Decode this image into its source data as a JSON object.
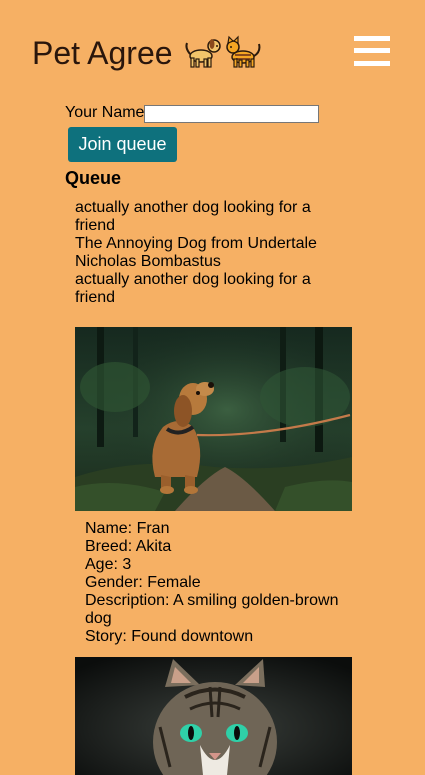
{
  "header": {
    "title": "Pet Agree",
    "title_emoji": "🐕🐈",
    "menu_icon": "hamburger-menu-icon"
  },
  "form": {
    "name_label": "Your Name",
    "name_value": "",
    "join_label": "Join queue"
  },
  "queue": {
    "heading": "Queue",
    "entries": [
      "actually another dog looking for a friend",
      "The Annoying Dog from Undertale",
      "Nicholas Bombastus",
      "actually another dog looking for a friend"
    ]
  },
  "pets": [
    {
      "image": "dog-photo",
      "name": "Name: Fran",
      "breed": "Breed: Akita",
      "age": "Age: 3",
      "gender": "Gender: Female",
      "description": "Description: A smiling golden-brown dog",
      "story": "Story: Found downtown"
    },
    {
      "image": "cat-photo"
    }
  ],
  "colors": {
    "background": "#f6b064",
    "button": "#0e717d",
    "title_text": "#2a160c",
    "menu_icon": "#ffffff"
  }
}
